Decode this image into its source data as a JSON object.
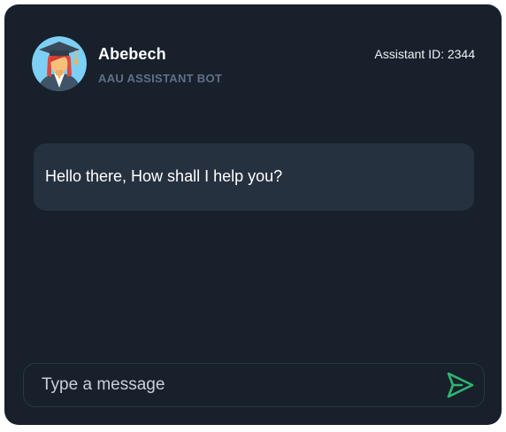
{
  "chat": {
    "bot_name": "Abebech",
    "bot_subtitle": "AAU ASSISTANT BOT",
    "assistant_id": "Assistant ID: 2344",
    "messages": [
      {
        "text": "Hello there, How shall I help you?"
      }
    ],
    "input": {
      "placeholder": "Type a message",
      "value": ""
    },
    "icons": {
      "avatar": "graduate-avatar-icon",
      "send": "send-icon"
    },
    "colors": {
      "background": "#18202b",
      "bubble": "#263140",
      "subtitle": "#5f7088",
      "send_accent": "#2db572"
    }
  }
}
